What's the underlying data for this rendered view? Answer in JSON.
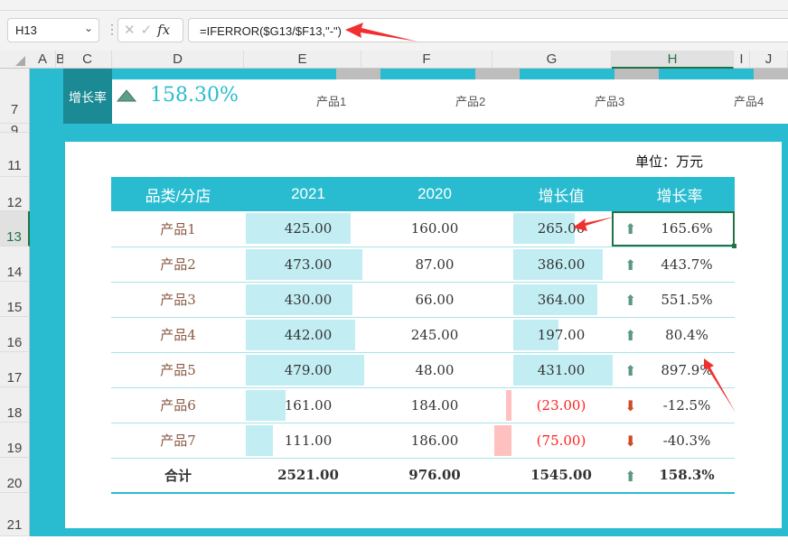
{
  "formula_bar": {
    "name_box": "H13",
    "formula": "=IFERROR($G13/$F13,\"-\")",
    "fx": "fx",
    "cancel": "✕",
    "confirm": "✓"
  },
  "columns": [
    "A",
    "B",
    "C",
    "D",
    "E",
    "F",
    "G",
    "H",
    "I",
    "J"
  ],
  "rows": [
    "7",
    "9",
    "11",
    "12",
    "13",
    "14",
    "15",
    "16",
    "17",
    "18",
    "19",
    "20",
    "21"
  ],
  "kpi": {
    "label": "增长率",
    "value": "158.30%"
  },
  "mini_chart_labels": [
    "产品1",
    "产品2",
    "产品3",
    "产品4"
  ],
  "unit": "单位：万元",
  "table": {
    "headers": [
      "品类/分店",
      "2021",
      "2020",
      "增长值",
      "增长率"
    ],
    "rows": [
      {
        "name": "产品1",
        "y2021": "425.00",
        "y2020": "160.00",
        "diff": "265.00",
        "rate": "165.6%",
        "v21": 425,
        "vd": 265,
        "up": true
      },
      {
        "name": "产品2",
        "y2021": "473.00",
        "y2020": "87.00",
        "diff": "386.00",
        "rate": "443.7%",
        "v21": 473,
        "vd": 386,
        "up": true
      },
      {
        "name": "产品3",
        "y2021": "430.00",
        "y2020": "66.00",
        "diff": "364.00",
        "rate": "551.5%",
        "v21": 430,
        "vd": 364,
        "up": true
      },
      {
        "name": "产品4",
        "y2021": "442.00",
        "y2020": "245.00",
        "diff": "197.00",
        "rate": "80.4%",
        "v21": 442,
        "vd": 197,
        "up": true
      },
      {
        "name": "产品5",
        "y2021": "479.00",
        "y2020": "48.00",
        "diff": "431.00",
        "rate": "897.9%",
        "v21": 479,
        "vd": 431,
        "up": true
      },
      {
        "name": "产品6",
        "y2021": "161.00",
        "y2020": "184.00",
        "diff": "(23.00)",
        "rate": "-12.5%",
        "v21": 161,
        "vd": -23,
        "up": false
      },
      {
        "name": "产品7",
        "y2021": "111.00",
        "y2020": "186.00",
        "diff": "(75.00)",
        "rate": "-40.3%",
        "v21": 111,
        "vd": -75,
        "up": false
      }
    ],
    "total": {
      "name": "合计",
      "y2021": "2521.00",
      "y2020": "976.00",
      "diff": "1545.00",
      "rate": "158.3%"
    }
  },
  "colors": {
    "teal": "#29bcd0",
    "bar_pos": "#c2eef3",
    "bar_neg": "#ffc0c0",
    "up": "#5a9a80",
    "down": "#d04a28"
  }
}
